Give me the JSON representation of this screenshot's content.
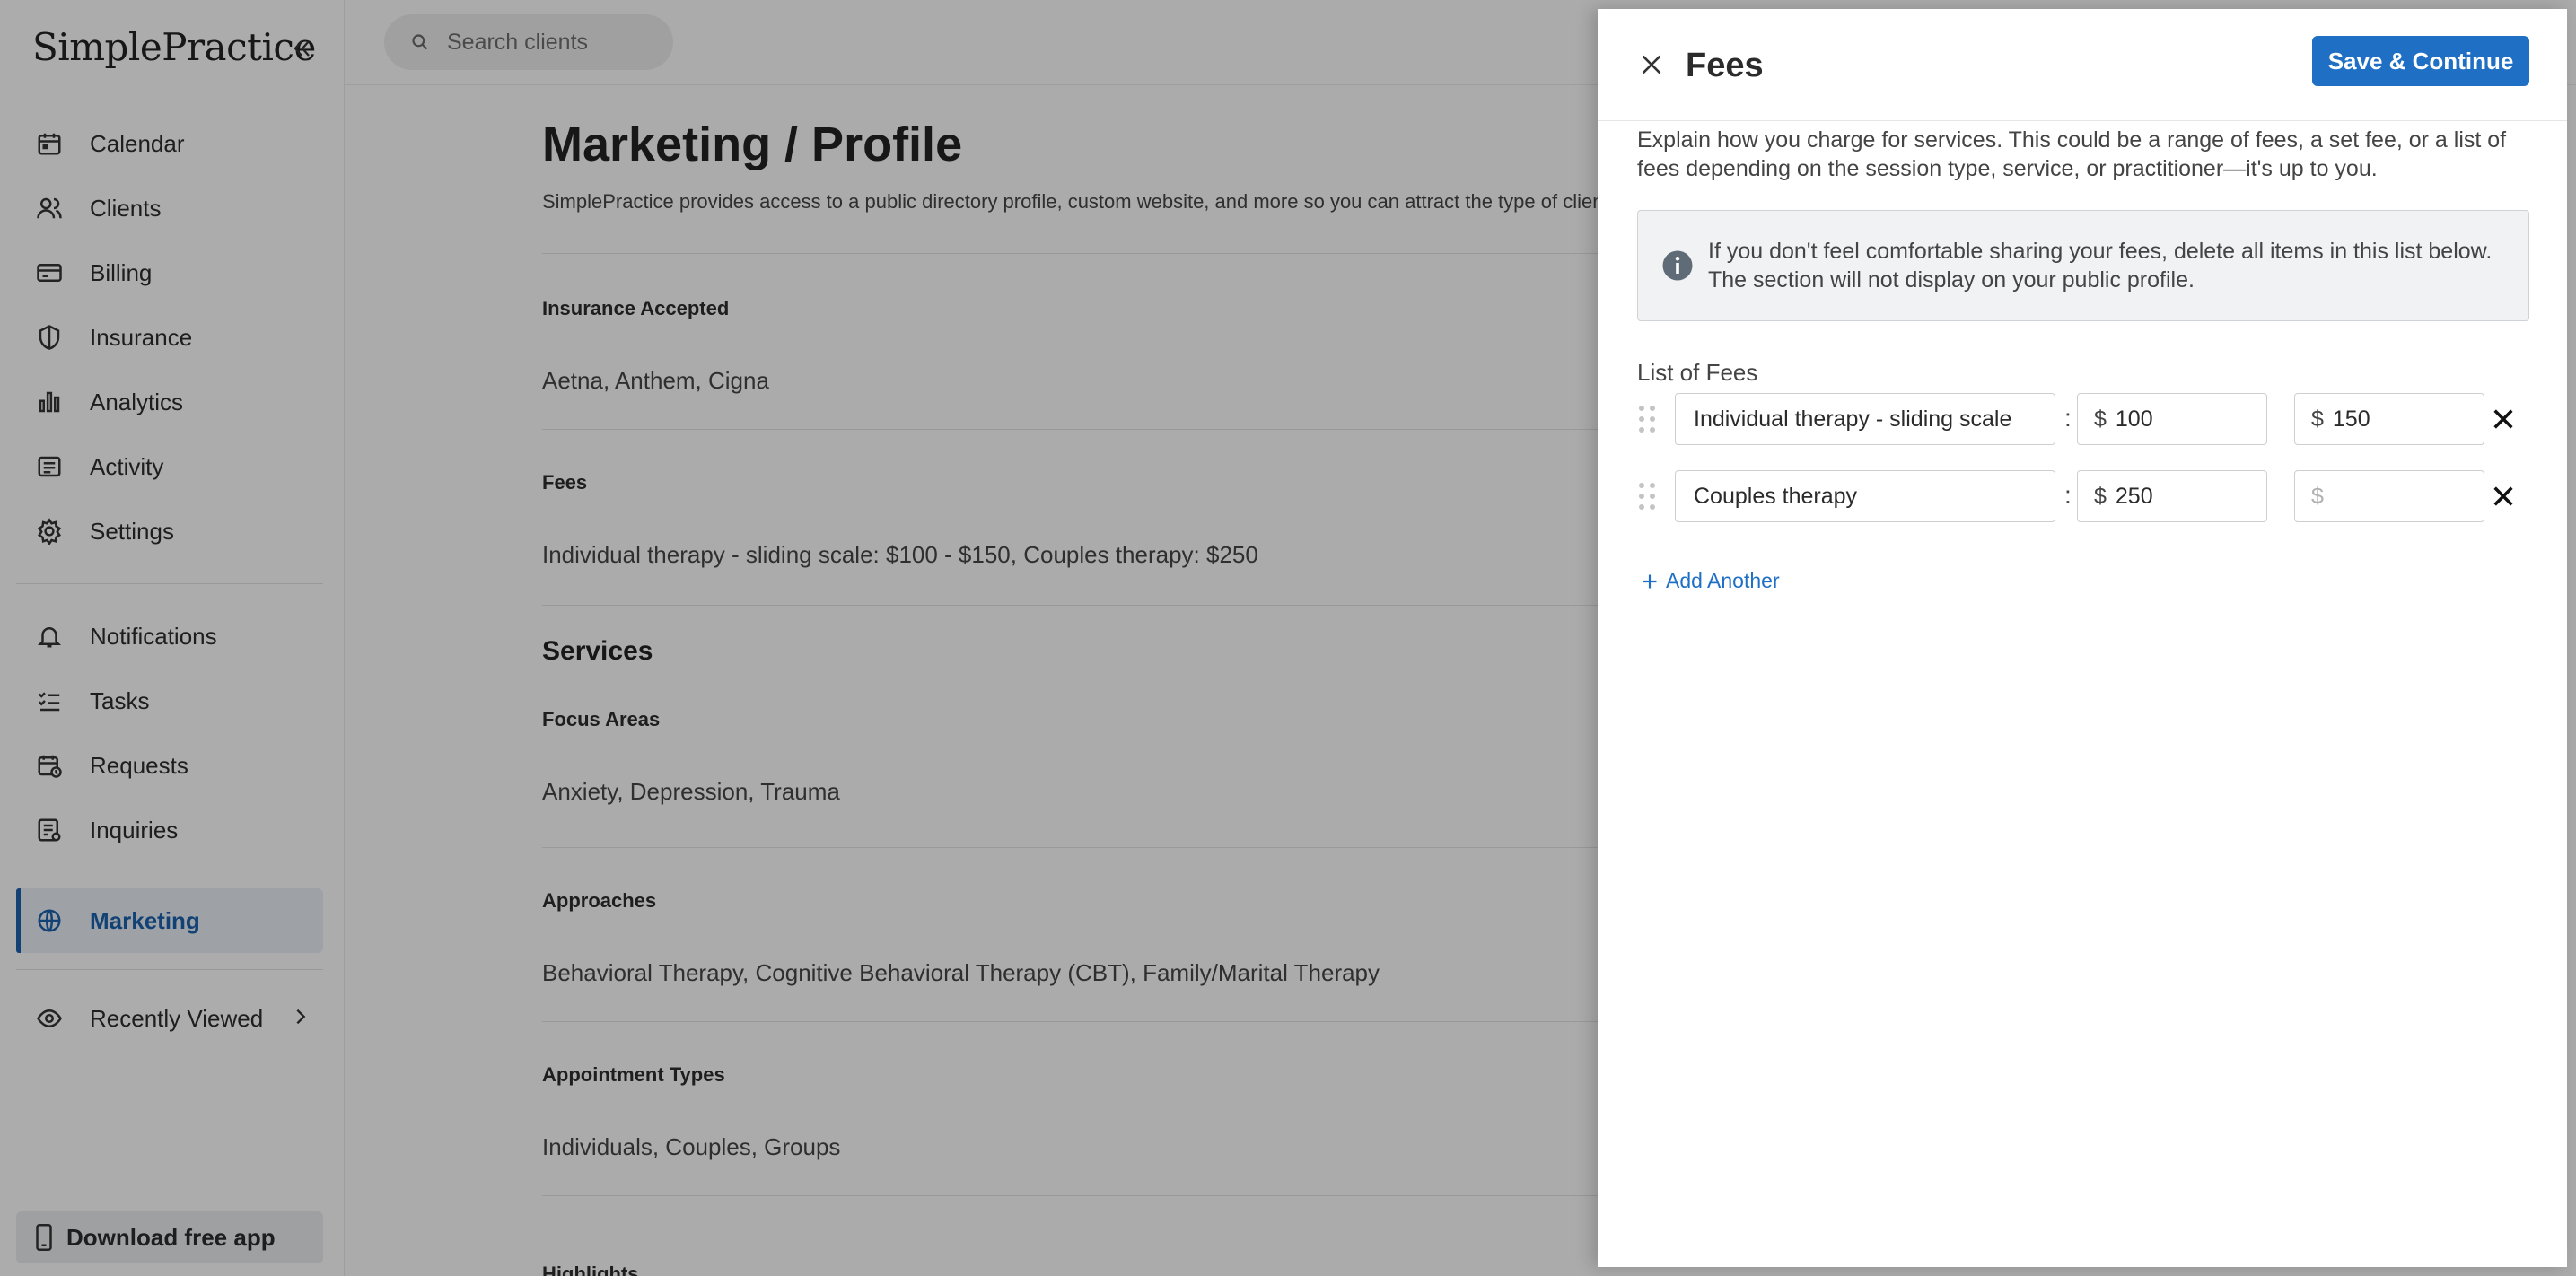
{
  "app": {
    "logo": "SimplePractice"
  },
  "sidebar": {
    "items": [
      {
        "label": "Calendar",
        "icon": "calendar-icon"
      },
      {
        "label": "Clients",
        "icon": "clients-icon"
      },
      {
        "label": "Billing",
        "icon": "billing-icon"
      },
      {
        "label": "Insurance",
        "icon": "shield-icon"
      },
      {
        "label": "Analytics",
        "icon": "analytics-icon"
      },
      {
        "label": "Activity",
        "icon": "activity-icon"
      },
      {
        "label": "Settings",
        "icon": "gear-icon"
      },
      {
        "label": "Notifications",
        "icon": "bell-icon"
      },
      {
        "label": "Tasks",
        "icon": "tasks-icon"
      },
      {
        "label": "Requests",
        "icon": "requests-icon"
      },
      {
        "label": "Inquiries",
        "icon": "inquiries-icon"
      },
      {
        "label": "Marketing",
        "icon": "globe-icon",
        "active": true
      },
      {
        "label": "Recently Viewed",
        "icon": "eye-icon"
      }
    ],
    "download_label": "Download free app"
  },
  "header": {
    "search_placeholder": "Search clients"
  },
  "main": {
    "title": "Marketing / Profile",
    "subtitle": "SimplePractice provides access to a public directory profile, custom website, and more so you can attract the type of clients you want to work with.",
    "insurance": {
      "label": "Insurance Accepted",
      "value": "Aetna, Anthem, Cigna"
    },
    "fees": {
      "label": "Fees",
      "value": "Individual therapy - sliding scale: $100 - $150, Couples therapy: $250"
    },
    "services_title": "Services",
    "focus": {
      "label": "Focus Areas",
      "value": "Anxiety, Depression, Trauma"
    },
    "approaches": {
      "label": "Approaches",
      "value": "Behavioral Therapy, Cognitive Behavioral Therapy (CBT), Family/Marital Therapy"
    },
    "appointments": {
      "label": "Appointment Types",
      "value": "Individuals, Couples, Groups"
    },
    "highlights": {
      "label": "Highlights"
    }
  },
  "drawer": {
    "title": "Fees",
    "save_label": "Save & Continue",
    "description": "Explain how you charge for services. This could be a range of fees, a set fee, or a list of fees depending on the session type, service, or practitioner—it's up to you.",
    "info": "If you don't feel comfortable sharing your fees, delete all items in this list below. The section will not display on your public profile.",
    "list_label": "List of Fees",
    "currency": "$",
    "separator": ":",
    "range_dash": "–",
    "rows": [
      {
        "name": "Individual therapy - sliding scale",
        "min": "100",
        "max": "150"
      },
      {
        "name": "Couples therapy",
        "min": "250",
        "max": ""
      }
    ],
    "add_label": "Add Another"
  }
}
